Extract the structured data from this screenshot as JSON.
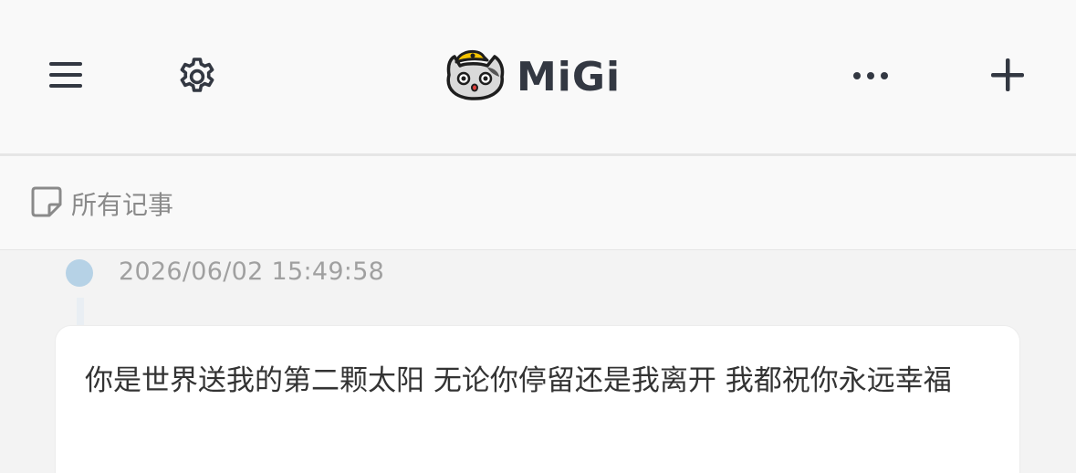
{
  "header": {
    "app_name": "MiGi",
    "menu_icon": "hamburger-menu-icon",
    "settings_icon": "gear-icon",
    "more_icon": "more-horizontal-icon",
    "add_icon": "plus-icon",
    "logo": "cat-with-yellow-cap-logo"
  },
  "filter": {
    "icon": "note-icon",
    "label": "所有记事"
  },
  "notes": [
    {
      "timestamp": "2026/06/02 15:49:58",
      "text": "你是世界送我的第二颗太阳 无论你停留还是我离开 我都祝你永远幸福"
    }
  ],
  "colors": {
    "text_dark": "#333842",
    "timeline_dot": "#b6d2e6",
    "logo_cap": "#f5c400"
  }
}
